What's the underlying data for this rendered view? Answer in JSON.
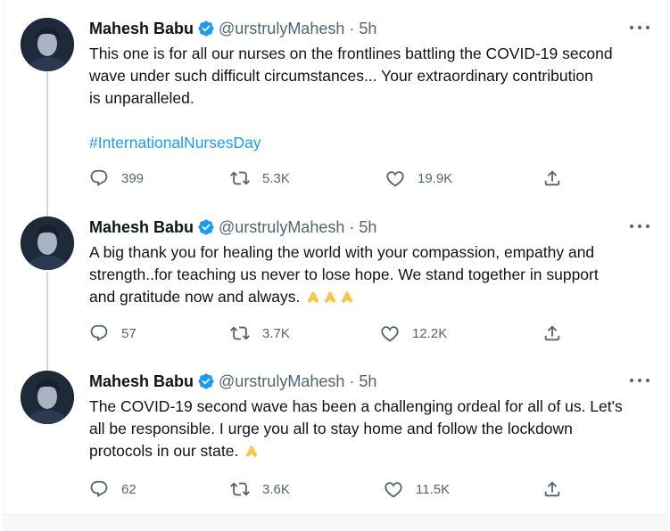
{
  "tweets": [
    {
      "name": "Mahesh Babu",
      "handle": "@urstrulyMahesh",
      "separator": "·",
      "time": "5h",
      "text_lines": [
        "This one is for all our nurses on the frontlines battling the COVID-19 second",
        "wave under such difficult circumstances... Your extraordinary contribution",
        "is unparalleled."
      ],
      "hashtag": "#InternationalNursesDay",
      "replies": "399",
      "retweets": "5.3K",
      "likes": "19.9K",
      "emoji_count": 0
    },
    {
      "name": "Mahesh Babu",
      "handle": "@urstrulyMahesh",
      "separator": "·",
      "time": "5h",
      "text_lines": [
        "A big thank you for healing the world with your compassion, empathy and",
        "strength..for teaching us never to lose hope. We stand together in support",
        "and gratitude now and always."
      ],
      "hashtag": "",
      "replies": "57",
      "retweets": "3.7K",
      "likes": "12.2K",
      "emoji_count": 3
    },
    {
      "name": "Mahesh Babu",
      "handle": "@urstrulyMahesh",
      "separator": "·",
      "time": "5h",
      "text_lines": [
        "The COVID-19 second wave has been a challenging ordeal for all of us. Let's",
        "all be responsible. I urge you all to stay home and follow the lockdown",
        "protocols in our state."
      ],
      "hashtag": "",
      "replies": "62",
      "retweets": "3.6K",
      "likes": "11.5K",
      "emoji_count": 1
    }
  ],
  "icons": {
    "verified": "verified-badge-icon",
    "more": "more-options-icon",
    "reply": "reply-icon",
    "retweet": "retweet-icon",
    "like": "like-icon",
    "share": "share-icon",
    "emoji": "folded-hands-emoji"
  },
  "colors": {
    "accent": "#1d9bf0",
    "text": "#0f1419",
    "secondary": "#536471",
    "thread_line": "#cfd9de",
    "emoji": "#f9c440"
  }
}
